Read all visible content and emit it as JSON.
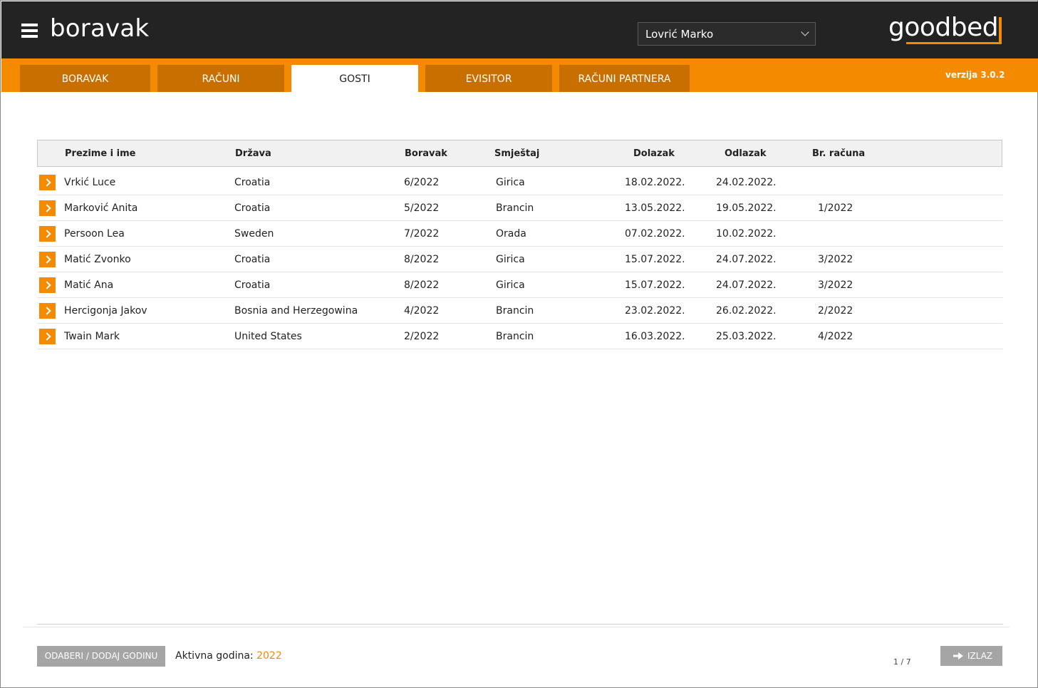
{
  "header": {
    "app_title": "boravak",
    "user_selected": "Lovrić Marko",
    "logo_text": "goodbed",
    "version": "verzija 3.0.2"
  },
  "tabs": [
    {
      "label": "BORAVAK",
      "active": false
    },
    {
      "label": "RAČUNI",
      "active": false
    },
    {
      "label": "GOSTI",
      "active": true
    },
    {
      "label": "EVISITOR",
      "active": false
    },
    {
      "label": "RAČUNI PARTNERA",
      "active": false
    }
  ],
  "table": {
    "columns": [
      "Prezime i ime",
      "Država",
      "Boravak",
      "Smještaj",
      "Dolazak",
      "Odlazak",
      "Br. računa"
    ],
    "rows": [
      {
        "name": "Vrkić Luce",
        "country": "Croatia",
        "stay": "6/2022",
        "accommodation": "Girica",
        "arrival": "18.02.2022.",
        "departure": "24.02.2022.",
        "invoice": ""
      },
      {
        "name": "Marković Anita",
        "country": "Croatia",
        "stay": "5/2022",
        "accommodation": "Brancin",
        "arrival": "13.05.2022.",
        "departure": "19.05.2022.",
        "invoice": "1/2022"
      },
      {
        "name": "Persoon Lea",
        "country": "Sweden",
        "stay": "7/2022",
        "accommodation": "Orada",
        "arrival": "07.02.2022.",
        "departure": "10.02.2022.",
        "invoice": ""
      },
      {
        "name": "Matić Zvonko",
        "country": "Croatia",
        "stay": "8/2022",
        "accommodation": "Girica",
        "arrival": "15.07.2022.",
        "departure": "24.07.2022.",
        "invoice": "3/2022"
      },
      {
        "name": "Matić Ana",
        "country": "Croatia",
        "stay": "8/2022",
        "accommodation": "Girica",
        "arrival": "15.07.2022.",
        "departure": "24.07.2022.",
        "invoice": "3/2022"
      },
      {
        "name": "Hercigonja Jakov",
        "country": "Bosnia and Herzegowina",
        "stay": "4/2022",
        "accommodation": "Brancin",
        "arrival": "23.02.2022.",
        "departure": "26.02.2022.",
        "invoice": "2/2022"
      },
      {
        "name": "Twain Mark",
        "country": "United States",
        "stay": "2/2022",
        "accommodation": "Brancin",
        "arrival": "16.03.2022.",
        "departure": "25.03.2022.",
        "invoice": "4/2022"
      }
    ]
  },
  "footer": {
    "select_year_button": "ODABERI / DODAJ GODINU",
    "active_year_label": "Aktivna godina: ",
    "active_year_value": "2022",
    "pager": "1 / 7",
    "exit_button": "IZLAZ"
  },
  "colors": {
    "accent": "#f38a00",
    "tab_inactive": "#c96f00",
    "header_bg": "#232323",
    "button_gray": "#a5a5a5"
  }
}
